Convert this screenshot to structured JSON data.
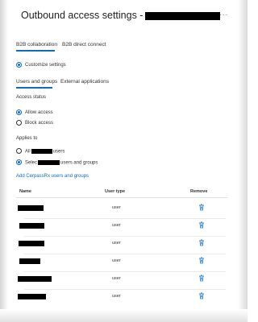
{
  "title": "Outbound access settings -",
  "more_label": "...",
  "tabs": [
    "B2B collaboration",
    "B2B direct connect"
  ],
  "customize_label": "Customize settings",
  "subtabs": [
    "Users and groups",
    "External applications"
  ],
  "access_status": {
    "heading": "Access status",
    "options": [
      "Allow access",
      "Block access"
    ],
    "selected": "Allow access"
  },
  "applies_to": {
    "heading": "Applies to",
    "all_prefix": "All",
    "all_suffix": "users",
    "select_prefix": "Selec",
    "select_suffix": "users and groups",
    "selected": "select"
  },
  "add_link": "Add CerpassRx users and groups",
  "table": {
    "headers": [
      "Name",
      "User type",
      "Remove"
    ],
    "rows": [
      {
        "user_type": "user",
        "remove_icon": "trash-icon"
      },
      {
        "user_type": "user",
        "remove_icon": "trash-icon"
      },
      {
        "user_type": "user",
        "remove_icon": "trash-icon"
      },
      {
        "user_type": "user",
        "remove_icon": "trash-icon"
      },
      {
        "user_type": "user",
        "remove_icon": "trash-icon"
      },
      {
        "user_type": "user",
        "remove_icon": "trash-icon"
      }
    ]
  },
  "colors": {
    "accent": "#0f6cbd",
    "text": "#323130",
    "redaction": "#000000"
  }
}
